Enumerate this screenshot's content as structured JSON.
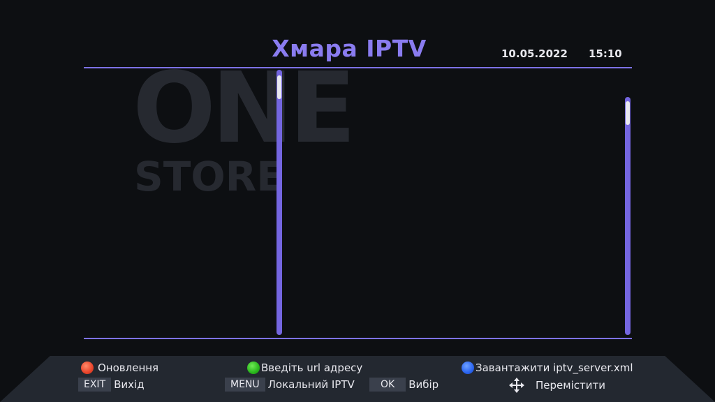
{
  "header": {
    "title": "Хмара IPTV",
    "date": "10.05.2022",
    "time": "15:10"
  },
  "watermark": {
    "line1": "ONE",
    "line2": "STORE"
  },
  "footer": {
    "red_label": "Оновлення",
    "green_label": "Введіть url адресу",
    "blue_label": "Завантажити iptv_server.xml",
    "exit_key": "EXIT",
    "exit_label": "Вихід",
    "menu_key": "MENU",
    "menu_label": "Локальний IPTV",
    "ok_key": "OK",
    "ok_label": "Вибір",
    "move_label": "Перемістити"
  },
  "colors": {
    "accent": "#7d72e6",
    "title": "#8a7cf0",
    "background": "#0d0f12"
  },
  "icons": {
    "red": "red-button-icon",
    "green": "green-button-icon",
    "blue": "blue-button-icon",
    "move": "move-arrows-icon"
  }
}
